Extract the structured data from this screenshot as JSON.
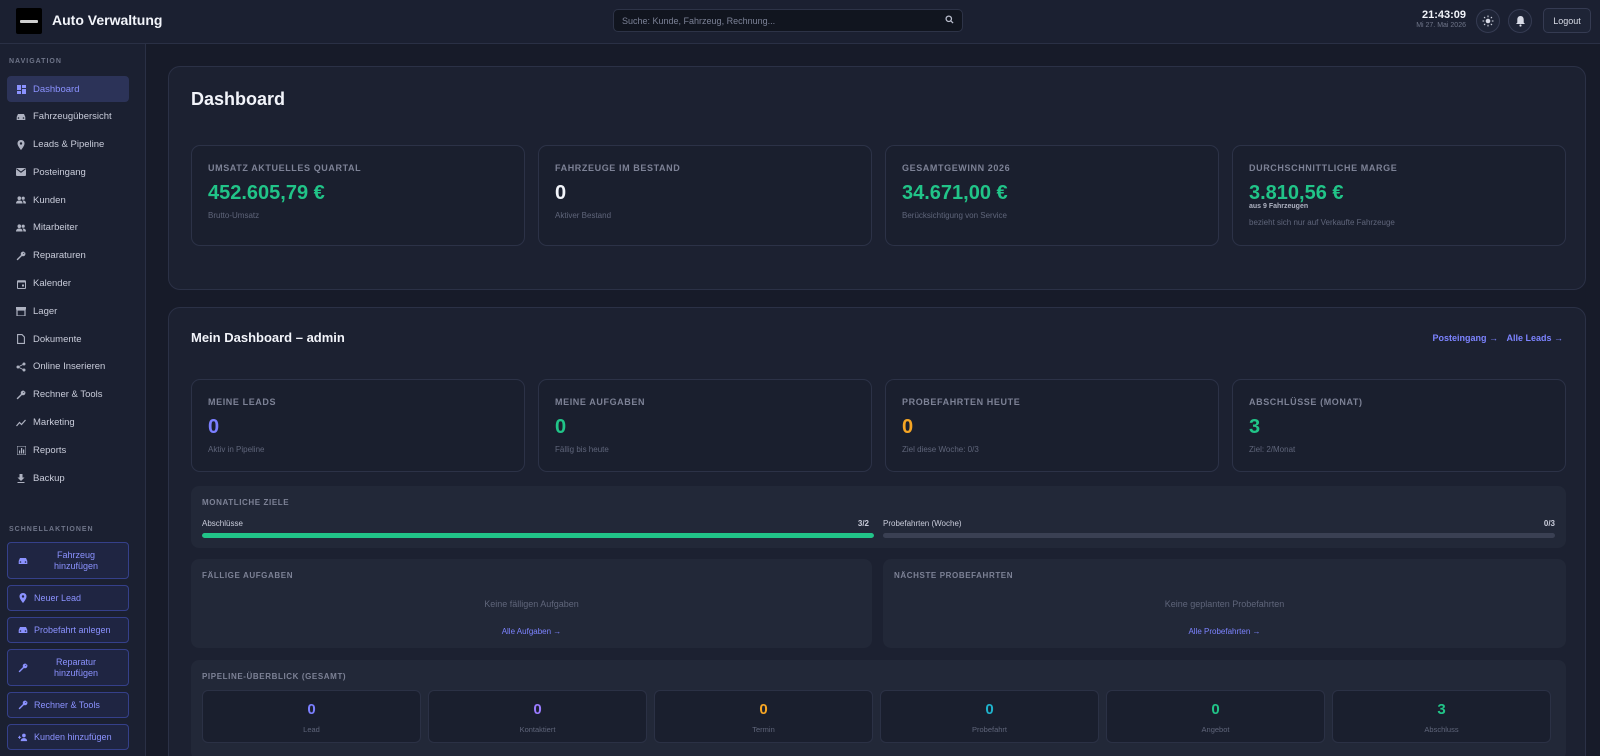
{
  "header": {
    "app_title": "Auto Verwaltung",
    "search_placeholder": "Suche: Kunde, Fahrzeug, Rechnung...",
    "time": "21:43:09",
    "date": "Mi 27. Mai 2026",
    "logout_label": "Logout",
    "icons": [
      "logo",
      "search-icon",
      "sun-icon",
      "bell-icon"
    ]
  },
  "sidebar": {
    "nav_title": "NAVIGATION",
    "items": [
      {
        "label": "Dashboard",
        "icon": "dashboard-icon",
        "active": true
      },
      {
        "label": "Fahrzeugübersicht",
        "icon": "car-icon"
      },
      {
        "label": "Leads & Pipeline",
        "icon": "pin-icon"
      },
      {
        "label": "Posteingang",
        "icon": "mail-icon"
      },
      {
        "label": "Kunden",
        "icon": "people-icon"
      },
      {
        "label": "Mitarbeiter",
        "icon": "people-icon"
      },
      {
        "label": "Reparaturen",
        "icon": "wrench-icon"
      },
      {
        "label": "Kalender",
        "icon": "calendar-icon"
      },
      {
        "label": "Lager",
        "icon": "box-icon"
      },
      {
        "label": "Dokumente",
        "icon": "document-icon"
      },
      {
        "label": "Online Inserieren",
        "icon": "share-icon"
      },
      {
        "label": "Rechner & Tools",
        "icon": "wrench-icon"
      },
      {
        "label": "Marketing",
        "icon": "trend-icon"
      },
      {
        "label": "Reports",
        "icon": "bar-chart-icon"
      },
      {
        "label": "Backup",
        "icon": "download-icon"
      }
    ],
    "quick_title": "SCHNELLAKTIONEN",
    "quick_actions": [
      {
        "label": "Fahrzeug hinzufügen",
        "icon": "car-icon"
      },
      {
        "label": "Neuer Lead",
        "icon": "pin-icon"
      },
      {
        "label": "Probefahrt anlegen",
        "icon": "car-icon"
      },
      {
        "label": "Reparatur hinzufügen",
        "icon": "wrench-icon"
      },
      {
        "label": "Rechner & Tools",
        "icon": "wrench-icon"
      },
      {
        "label": "Kunden hinzufügen",
        "icon": "add-person-icon"
      }
    ]
  },
  "dashboard": {
    "title": "Dashboard",
    "stats": [
      {
        "label": "UMSATZ AKTUELLES QUARTAL",
        "value": "452.605,79 €",
        "sub": "Brutto-Umsatz",
        "color": "#21c488"
      },
      {
        "label": "FAHRZEUGE IM BESTAND",
        "value": "0",
        "sub": "Aktiver Bestand",
        "color": "#f2f4fa"
      },
      {
        "label": "GESAMTGEWINN 2026",
        "value": "34.671,00 €",
        "sub": "Berücksichtigung von Service",
        "color": "#21c488"
      },
      {
        "label": "DURCHSCHNITTLICHE MARGE",
        "value": "3.810,56 €",
        "note": "aus 9 Fahrzeugen",
        "sub": "bezieht sich nur auf Verkaufte Fahrzeuge",
        "color": "#21c488"
      }
    ]
  },
  "my_dashboard": {
    "title": "Mein Dashboard – admin",
    "link_inbox": "Posteingang →",
    "link_leads": "Alle Leads →",
    "kpis": [
      {
        "label": "MEINE LEADS",
        "value": "0",
        "sub": "Aktiv in Pipeline",
        "color": "#7b7fff"
      },
      {
        "label": "MEINE AUFGABEN",
        "value": "0",
        "sub": "Fällig bis heute",
        "color": "#21c488"
      },
      {
        "label": "PROBEFAHRTEN HEUTE",
        "value": "0",
        "sub": "Ziel diese Woche: 0/3",
        "color": "#f5a524"
      },
      {
        "label": "ABSCHLÜSSE (MONAT)",
        "value": "3",
        "sub": "Ziel: 2/Monat",
        "color": "#21c488"
      }
    ],
    "goals": {
      "title": "MONATLICHE ZIELE",
      "items": [
        {
          "label": "Abschlüsse",
          "value": "3/2",
          "progress": 1.0
        },
        {
          "label": "Probefahrten (Woche)",
          "value": "0/3",
          "progress": 0.0
        }
      ]
    },
    "tasks": {
      "title": "FÄLLIGE AUFGABEN",
      "empty": "Keine fälligen Aufgaben",
      "link": "Alle Aufgaben →"
    },
    "test_drives": {
      "title": "NÄCHSTE PROBEFAHRTEN",
      "empty": "Keine geplanten Probefahrten",
      "link": "Alle Probefahrten →"
    },
    "pipeline": {
      "title": "PIPELINE-ÜBERBLICK (GESAMT)",
      "stages": [
        {
          "label": "Lead",
          "value": "0",
          "color": "#7b7fff"
        },
        {
          "label": "Kontaktiert",
          "value": "0",
          "color": "#9a7bff"
        },
        {
          "label": "Termin",
          "value": "0",
          "color": "#f5a524"
        },
        {
          "label": "Probefahrt",
          "value": "0",
          "color": "#1fb3cc"
        },
        {
          "label": "Angebot",
          "value": "0",
          "color": "#21c488"
        },
        {
          "label": "Abschluss",
          "value": "3",
          "color": "#21c488"
        }
      ]
    }
  }
}
